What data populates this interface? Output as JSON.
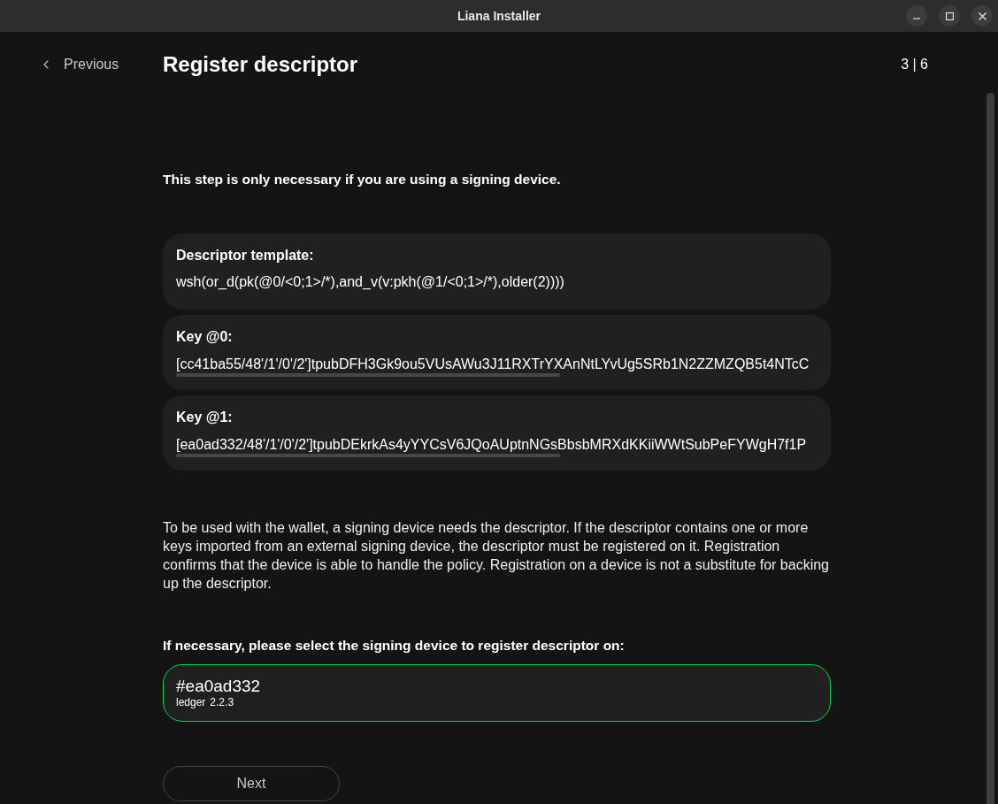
{
  "window": {
    "title": "Liana Installer"
  },
  "header": {
    "back": "Previous",
    "title": "Register descriptor",
    "step": "3 | 6"
  },
  "intro": "This step is only necessary if you are using a signing device.",
  "cards": [
    {
      "kind": "text",
      "label": "Descriptor template:",
      "value": "wsh(or_d(pk(@0/<0;1>/*),and_v(v:pkh(@1/<0;1>/*),older(2))))"
    },
    {
      "kind": "scroll",
      "label": "Key @0:",
      "value": "[cc41ba55/48'/1'/0'/2']tpubDFH3Gk9ou5VUsAWu3J11RXTrYXAnNtLYvUg5SRb1N2ZZMZQB5t4NTcC"
    },
    {
      "kind": "scroll",
      "label": "Key @1:",
      "value": "[ea0ad332/48'/1'/0'/2']tpubDEkrkAs4yYYCsV6JQoAUptnNGsBbsbMRXdKKiiWWtSubPeFYWgH7f1P"
    }
  ],
  "description": "To be used with the wallet, a signing device needs the descriptor. If the descriptor contains one or more keys imported from an external signing device, the descriptor must be registered on it. Registration confirms that the device is able to handle the policy. Registration on a device is not a substitute for backing up the descriptor.",
  "prompt": "If necessary, please select the signing device to register descriptor on:",
  "devices": [
    {
      "fingerprint": "#ea0ad332",
      "kind": "ledger",
      "version": "2.2.3",
      "selected": true
    }
  ],
  "next": "Next"
}
